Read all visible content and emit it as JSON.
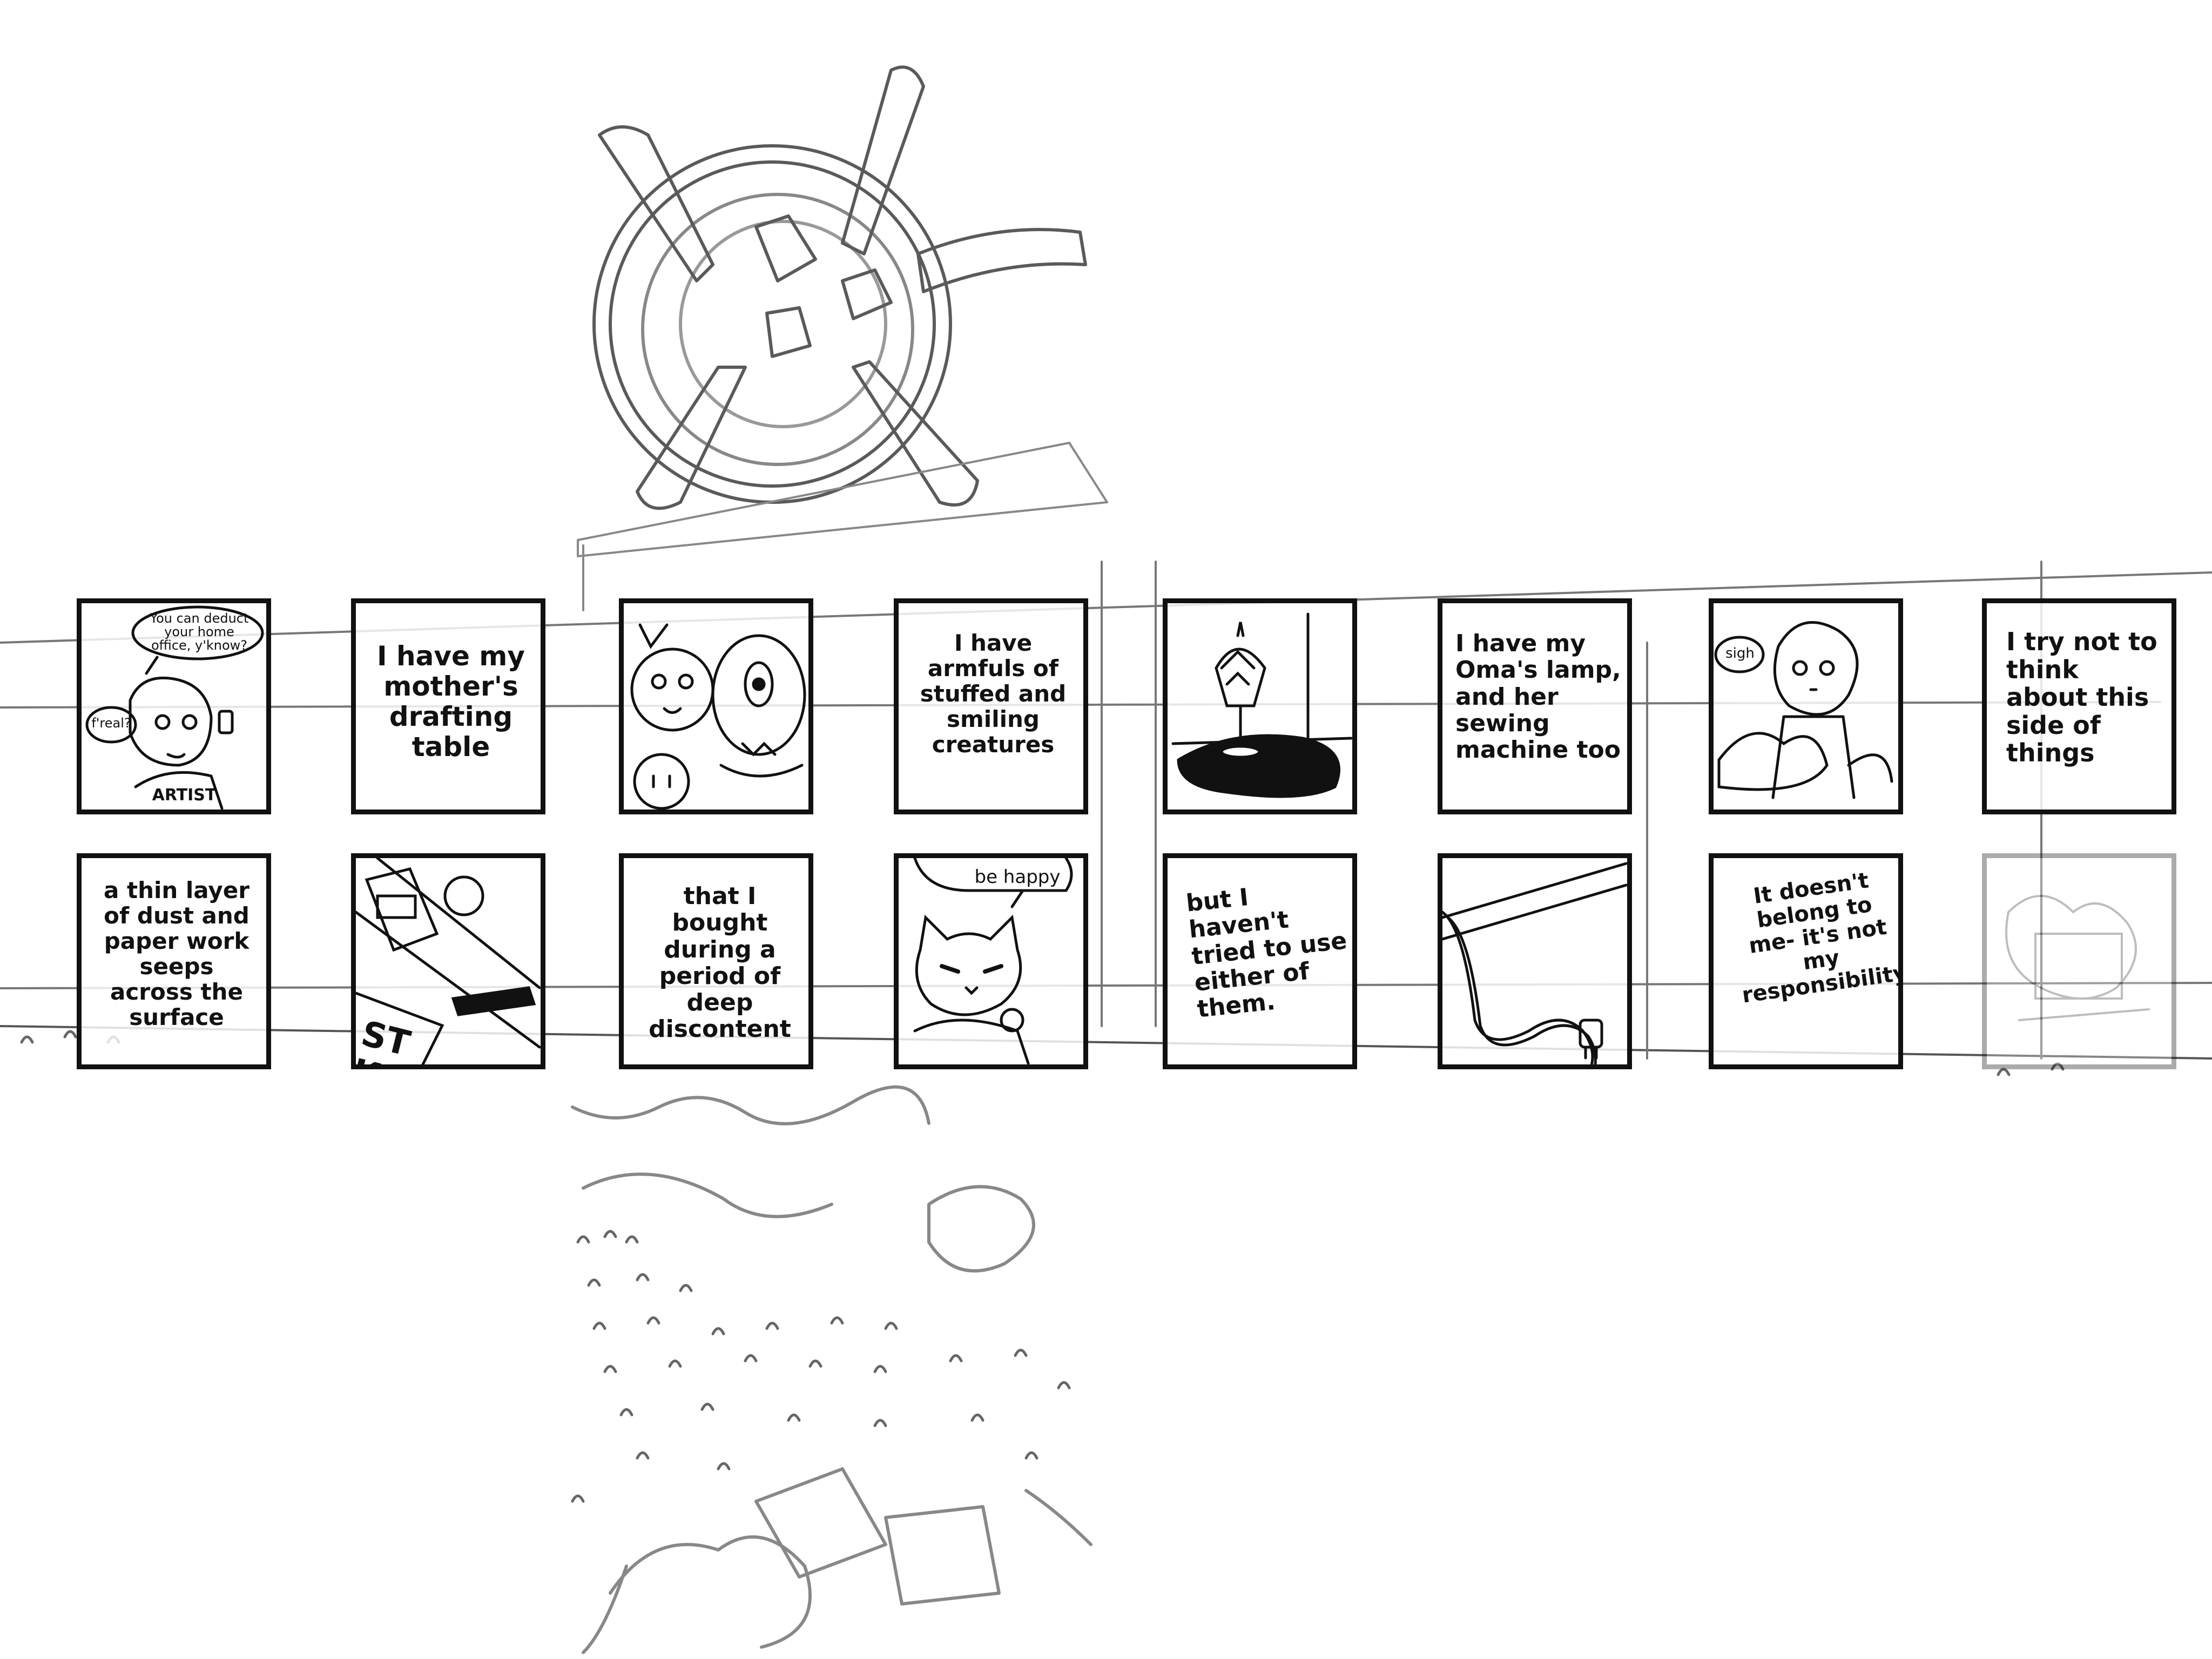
{
  "panels": {
    "p1": {
      "speech_1": "You can deduct your home office, y'know?",
      "speech_2": "f'real?",
      "shirt": "ARTIST"
    },
    "p2": {
      "caption": "I have my mother's drafting table"
    },
    "p3": {},
    "p4": {
      "caption": "I have armfuls of stuffed and smiling creatures"
    },
    "p5": {},
    "p6": {
      "caption": "I have my Oma's lamp, and her sewing machine too"
    },
    "p7": {
      "speech": "sigh"
    },
    "p8": {
      "caption": "I try not to think about this side of things"
    },
    "p9": {
      "caption": "a thin layer of dust and paper work seeps across the surface"
    },
    "p10": {
      "label": "ST KI"
    },
    "p11": {
      "caption": "that I bought during a period of deep discontent"
    },
    "p12": {
      "speech": "be happy"
    },
    "p13": {
      "caption": "but I haven't tried to use either of them."
    },
    "p14": {},
    "p15": {
      "caption": "It doesn't belong to me- it's not my responsibility"
    },
    "p16": {}
  },
  "colors": {
    "ink": "#111111",
    "sketch": "#5a5a5a",
    "faint_sketch": "#b5b5b5"
  }
}
